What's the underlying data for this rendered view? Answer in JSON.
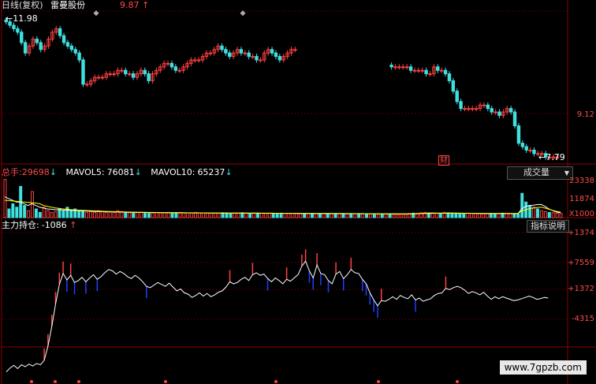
{
  "colors": {
    "up": "#ff4040",
    "down": "#40e0e0",
    "grid": "#8b0000",
    "text_red": "#ff4a4a",
    "text_white": "#e0e0e0",
    "line_white": "#ffffff",
    "ma_yellow": "#ffff00"
  },
  "header": {
    "mode": "日线(复权)",
    "stock_name": "雷曼股份",
    "price_marker": "9.87",
    "price_marker_arrow": "↑",
    "high_label": "11.98",
    "low_label": "7.79",
    "event_tag": "财"
  },
  "price_axis": {
    "labels": [
      "9.12"
    ]
  },
  "volume_header": {
    "total_label": "总手:",
    "total_value": "29698",
    "total_arrow": "↓",
    "mavol5_label": "MAVOL5:",
    "mavol5_value": "76081",
    "mavol5_arrow": "↓",
    "mavol10_label": "MAVOL10:",
    "mavol10_value": "65237",
    "mavol10_arrow": "↓",
    "dropdown_label": "成交量",
    "dropdown_icon": "triangle-down"
  },
  "volume_axis": {
    "labels": [
      "23338",
      "11874",
      "X1000"
    ]
  },
  "indicator_header": {
    "label": "主力持仓:",
    "value": "-1086",
    "arrow": "↑",
    "button": "指标说明"
  },
  "indicator_axis": {
    "labels": [
      "+1374",
      "+7559",
      "+1372",
      "-4315"
    ]
  },
  "watermark": "www.7gpzb.com",
  "chart_data": [
    {
      "type": "candlestick",
      "title": "雷曼股份",
      "ylim": [
        7.6,
        12.1
      ],
      "x": [
        1,
        2,
        3,
        4,
        5,
        6,
        7,
        8,
        9,
        10,
        11,
        12,
        13,
        14,
        15,
        16,
        17,
        18,
        19,
        20,
        21,
        22,
        23,
        24,
        25,
        26,
        27,
        28,
        29,
        30,
        31,
        32,
        33,
        34,
        35,
        36,
        37,
        38,
        39,
        40,
        41,
        42,
        43,
        44,
        45,
        46,
        47,
        48,
        49,
        50,
        51,
        52,
        53,
        54,
        55,
        56,
        57,
        58,
        59,
        60,
        61,
        62,
        63,
        64,
        65,
        66,
        67,
        68,
        69,
        70,
        71,
        72,
        73,
        74,
        75,
        76,
        77,
        78,
        79,
        80,
        81,
        82,
        83,
        84,
        85,
        86,
        87,
        88,
        89,
        90,
        91,
        92,
        93,
        94,
        95,
        96,
        97,
        98,
        99,
        100,
        101,
        102,
        103,
        104,
        105,
        106,
        107,
        108,
        109,
        110,
        111,
        112,
        113,
        114,
        115,
        116,
        117,
        118,
        119,
        120,
        121,
        122,
        123,
        124,
        125,
        126,
        127,
        128,
        129,
        130,
        131,
        132,
        133,
        134,
        135,
        136,
        137,
        138,
        139,
        140,
        141,
        142,
        143,
        144
      ],
      "close": [
        11.7,
        11.6,
        11.5,
        11.4,
        11.1,
        10.8,
        11.0,
        11.2,
        11.1,
        10.9,
        11.0,
        11.2,
        11.4,
        11.5,
        11.3,
        11.1,
        11.0,
        10.9,
        10.8,
        10.6,
        9.9,
        9.9,
        10.0,
        10.1,
        10.1,
        10.1,
        10.2,
        10.2,
        10.2,
        10.3,
        10.3,
        10.2,
        10.2,
        10.1,
        10.2,
        10.3,
        10.2,
        10.0,
        10.2,
        10.3,
        10.4,
        10.5,
        10.5,
        10.4,
        10.3,
        10.3,
        10.4,
        10.5,
        10.6,
        10.6,
        10.6,
        10.7,
        10.8,
        10.8,
        10.9,
        11.0,
        10.9,
        10.8,
        10.7,
        10.8,
        10.9,
        10.8,
        10.8,
        10.7,
        10.7,
        10.6,
        10.6,
        10.8,
        10.9,
        10.8,
        10.7,
        10.6,
        10.7,
        10.8,
        10.9,
        10.9,
        null,
        null,
        null,
        null,
        null,
        null,
        null,
        null,
        null,
        null,
        null,
        null,
        null,
        null,
        null,
        null,
        null,
        null,
        null,
        null,
        null,
        null,
        null,
        null,
        10.4,
        10.4,
        10.4,
        10.4,
        10.4,
        10.3,
        10.3,
        10.3,
        10.3,
        10.2,
        10.2,
        10.4,
        10.3,
        10.3,
        10.2,
        10.0,
        9.7,
        9.4,
        9.2,
        9.2,
        9.2,
        9.2,
        9.2,
        9.3,
        9.3,
        9.2,
        9.1,
        9.1,
        9.0,
        9.1,
        9.2,
        9.1,
        8.7,
        8.2,
        8.1,
        8.0,
        8.0,
        7.9,
        7.9,
        7.9,
        7.8,
        7.8,
        7.8,
        7.8
      ],
      "high_label": 11.98,
      "low_label": 7.79
    },
    {
      "type": "bar",
      "title": "成交量",
      "ylim": [
        0,
        25000
      ],
      "values": [
        22000,
        5000,
        8000,
        6000,
        18000,
        7000,
        4000,
        15000,
        5000,
        3000,
        6000,
        4000,
        3000,
        3500,
        5000,
        4000,
        6000,
        4500,
        5000,
        3500,
        4000,
        3000,
        3500,
        3000,
        4000,
        3500,
        3000,
        3200,
        3000,
        4000,
        3500,
        3000,
        2800,
        3000,
        2900,
        3100,
        3000,
        2800,
        2700,
        3000,
        2900,
        2800,
        3000,
        2700,
        2900,
        3000,
        2800,
        2700,
        2600,
        3000,
        2800,
        2700,
        2600,
        2500,
        2700,
        2600,
        2800,
        2700,
        2500,
        2600,
        2700,
        2800,
        2600,
        2500,
        2700,
        2600,
        2500,
        2400,
        2600,
        2500,
        2400,
        2600,
        2500,
        2400,
        2500,
        2300,
        2400,
        2300,
        2500,
        2400,
        2300,
        2200,
        2400,
        2300,
        2200,
        2100,
        2300,
        2200,
        2100,
        2000,
        2200,
        2100,
        2000,
        1900,
        2100,
        2000,
        1900,
        1800,
        2000,
        1900,
        1800,
        1700,
        1900,
        1800,
        2400,
        2600,
        2500,
        2800,
        3000,
        2700,
        2600,
        2500,
        2400,
        3000,
        2800,
        2600,
        2500,
        2400,
        2300,
        2600,
        2500,
        2400,
        2300,
        2200,
        2500,
        2400,
        2300,
        2200,
        2600,
        2500,
        2400,
        2300,
        2200,
        14000,
        9000,
        7000,
        6000,
        5000,
        4000,
        3500,
        3000,
        2800,
        2600,
        2400
      ],
      "mavol5": [
        12000,
        11000,
        10000,
        9000,
        9000,
        8000,
        7000,
        8000,
        7000,
        6000,
        5500,
        5000,
        4800,
        4600,
        4500,
        4400,
        4300,
        4200,
        4100,
        4000,
        3900,
        3800,
        3700,
        3600,
        3500,
        3450,
        3400,
        3350,
        3300,
        3250,
        3200,
        3150,
        3100,
        3050,
        3000,
        2980,
        2960,
        2940,
        2920,
        2900,
        2880,
        2860,
        2840,
        2820,
        2800,
        2780,
        2760,
        2740,
        2720,
        2700,
        2690,
        2680,
        2670,
        2660,
        2650,
        2640,
        2630,
        2620,
        2610,
        2600,
        2590,
        2580,
        2570,
        2560,
        2550,
        2540,
        2530,
        2520,
        2510,
        2500,
        2490,
        2480,
        2470,
        2460,
        2450,
        2440,
        2430,
        2420,
        2410,
        2400,
        2390,
        2380,
        2370,
        2360,
        2350,
        2340,
        2330,
        2320,
        2310,
        2300,
        2290,
        2280,
        2270,
        2260,
        2250,
        2240,
        2230,
        2220,
        2210,
        2200,
        2190,
        2180,
        2170,
        2160,
        2150,
        2200,
        2300,
        2400,
        2500,
        2600,
        2700,
        2650,
        2600,
        2550,
        2600,
        2650,
        2600,
        2550,
        2500,
        2480,
        2460,
        2440,
        2420,
        2400,
        2380,
        2400,
        2420,
        2400,
        2380,
        2360,
        2340,
        2320,
        2300,
        5000,
        6500,
        7000,
        7200,
        7500,
        7600,
        6500,
        5000,
        4000,
        3200,
        2800
      ],
      "mavol10": [
        10000,
        9800,
        9600,
        9400,
        9200,
        9000,
        8800,
        8600,
        8400,
        8000,
        7000,
        6500,
        6000,
        5600,
        5300,
        5000,
        4800,
        4600,
        4450,
        4300,
        4200,
        4100,
        4000,
        3900,
        3800,
        3700,
        3600,
        3500,
        3450,
        3400,
        3350,
        3300,
        3250,
        3200,
        3150,
        3100,
        3060,
        3020,
        2990,
        2960,
        2930,
        2900,
        2880,
        2860,
        2840,
        2820,
        2800,
        2780,
        2760,
        2740,
        2720,
        2710,
        2700,
        2690,
        2680,
        2670,
        2660,
        2650,
        2640,
        2630,
        2620,
        2610,
        2600,
        2590,
        2580,
        2570,
        2560,
        2550,
        2540,
        2530,
        2520,
        2510,
        2500,
        2490,
        2480,
        2470,
        2460,
        2450,
        2440,
        2430,
        2420,
        2410,
        2400,
        2390,
        2380,
        2370,
        2360,
        2350,
        2340,
        2330,
        2320,
        2310,
        2300,
        2290,
        2280,
        2270,
        2260,
        2250,
        2240,
        2230,
        2220,
        2210,
        2200,
        2190,
        2180,
        2200,
        2250,
        2300,
        2350,
        2400,
        2450,
        2500,
        2500,
        2520,
        2540,
        2560,
        2560,
        2550,
        2540,
        2520,
        2500,
        2480,
        2460,
        2440,
        2420,
        2420,
        2420,
        2410,
        2400,
        2390,
        2380,
        2370,
        2360,
        3800,
        4500,
        5200,
        5500,
        5800,
        6000,
        5500,
        4800,
        4200,
        3600,
        3200
      ]
    },
    {
      "type": "line",
      "title": "主力持仓",
      "ylim": [
        -6800,
        14500
      ],
      "values": [
        -7000,
        -6400,
        -6000,
        -6500,
        -5900,
        -6200,
        -5800,
        -6100,
        -5700,
        -5900,
        -5200,
        -3000,
        0,
        3500,
        6500,
        8200,
        7200,
        7900,
        6800,
        7100,
        7600,
        6900,
        7500,
        8000,
        7300,
        7700,
        8300,
        8800,
        8600,
        8100,
        8500,
        8200,
        7700,
        7400,
        7900,
        7500,
        6900,
        6200,
        6000,
        6400,
        6800,
        6500,
        6200,
        6700,
        6100,
        5500,
        5800,
        5200,
        5000,
        4500,
        4800,
        5200,
        4700,
        5100,
        4600,
        4900,
        5300,
        5500,
        6100,
        6900,
        6600,
        6800,
        7300,
        7600,
        7100,
        8000,
        8300,
        7900,
        8100,
        7400,
        6900,
        7500,
        7100,
        6600,
        7300,
        7000,
        7500,
        8000,
        9300,
        10100,
        8600,
        7500,
        9500,
        8200,
        8000,
        7100,
        6600,
        8100,
        8500,
        7400,
        8000,
        8800,
        8300,
        8200,
        7300,
        6600,
        5200,
        4100,
        3200,
        4000,
        3900,
        4200,
        4600,
        4200,
        4800,
        4500,
        4300,
        4900,
        4100,
        4400,
        3900,
        4100,
        4300,
        4800,
        5100,
        5200,
        5900,
        5700,
        6000,
        6200,
        6000,
        5600,
        5100,
        5400,
        5200,
        4900,
        5300,
        4700,
        4200,
        4600,
        4300,
        4600,
        4400,
        4200,
        4000,
        4100,
        4300,
        4500,
        4700,
        4500,
        4200,
        4300,
        4500,
        4400
      ]
    }
  ]
}
